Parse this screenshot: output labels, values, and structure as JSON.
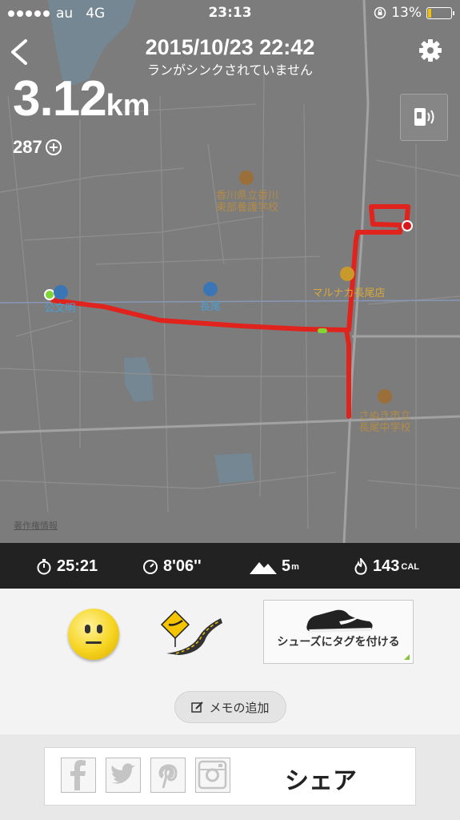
{
  "status_bar": {
    "carrier": "au",
    "network": "4G",
    "time": "23:13",
    "battery": "13%",
    "battery_level": 0.13
  },
  "header": {
    "date": "2015/10/23  22:42",
    "subtitle": "ランがシンクされていません"
  },
  "summary": {
    "distance": "3.12",
    "distance_unit": "km",
    "fuel": "287"
  },
  "map": {
    "labels": {
      "school1": "香川県立香川\n東部養護学校",
      "station1": "公文明",
      "station2": "長尾",
      "store": "マルナカ長尾店",
      "school2": "さぬき市立\n長尾中学校"
    },
    "copyright": "著作権情報",
    "route_color": "#e0231c"
  },
  "stats": {
    "duration": "25:21",
    "pace": "8'06''",
    "elevation": "5",
    "elevation_unit": "m",
    "calories": "143",
    "calories_unit": "CAL"
  },
  "actions": {
    "shoe_tag": "シューズにタグを付ける",
    "memo": "メモの追加"
  },
  "share": {
    "label": "シェア",
    "icons": [
      "facebook-icon",
      "twitter-icon",
      "pinterest-icon",
      "instagram-icon"
    ]
  }
}
